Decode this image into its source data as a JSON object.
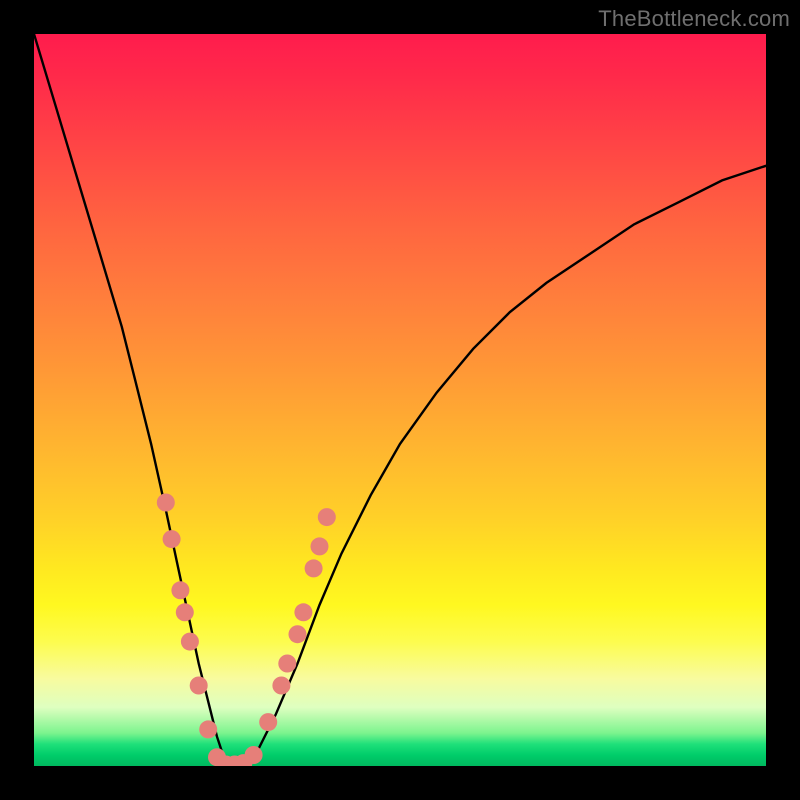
{
  "watermark": "TheBottleneck.com",
  "chart_data": {
    "type": "line",
    "title": "",
    "xlabel": "",
    "ylabel": "",
    "xlim": [
      0,
      100
    ],
    "ylim": [
      0,
      100
    ],
    "grid": false,
    "legend": false,
    "background_gradient": {
      "orientation": "vertical",
      "stops": [
        {
          "pos": 0,
          "color": "#ff1c4d"
        },
        {
          "pos": 50,
          "color": "#ffb430"
        },
        {
          "pos": 80,
          "color": "#fff820"
        },
        {
          "pos": 95,
          "color": "#7cf48e"
        },
        {
          "pos": 100,
          "color": "#00b85f"
        }
      ]
    },
    "series": [
      {
        "name": "bottleneck-curve",
        "color": "#000000",
        "x": [
          0,
          3,
          6,
          9,
          12,
          14,
          16,
          18,
          19.5,
          21,
          22.5,
          24,
          25,
          26,
          27,
          28.5,
          30,
          33,
          36,
          39,
          42,
          46,
          50,
          55,
          60,
          65,
          70,
          76,
          82,
          88,
          94,
          100
        ],
        "y": [
          100,
          90,
          80,
          70,
          60,
          52,
          44,
          35,
          28,
          21,
          14,
          8,
          4,
          1,
          0,
          0,
          1,
          7,
          14,
          22,
          29,
          37,
          44,
          51,
          57,
          62,
          66,
          70,
          74,
          77,
          80,
          82
        ]
      }
    ],
    "markers": {
      "name": "highlight-points",
      "color": "#e67f79",
      "radius": 9,
      "points": [
        {
          "x": 18.0,
          "y": 36
        },
        {
          "x": 18.8,
          "y": 31
        },
        {
          "x": 20.0,
          "y": 24
        },
        {
          "x": 20.6,
          "y": 21
        },
        {
          "x": 21.3,
          "y": 17
        },
        {
          "x": 22.5,
          "y": 11
        },
        {
          "x": 23.8,
          "y": 5
        },
        {
          "x": 25.0,
          "y": 1.2
        },
        {
          "x": 26.2,
          "y": 0.2
        },
        {
          "x": 27.4,
          "y": 0.2
        },
        {
          "x": 28.6,
          "y": 0.4
        },
        {
          "x": 30.0,
          "y": 1.5
        },
        {
          "x": 32.0,
          "y": 6
        },
        {
          "x": 33.8,
          "y": 11
        },
        {
          "x": 34.6,
          "y": 14
        },
        {
          "x": 36.0,
          "y": 18
        },
        {
          "x": 36.8,
          "y": 21
        },
        {
          "x": 38.2,
          "y": 27
        },
        {
          "x": 39.0,
          "y": 30
        },
        {
          "x": 40.0,
          "y": 34
        }
      ]
    }
  }
}
